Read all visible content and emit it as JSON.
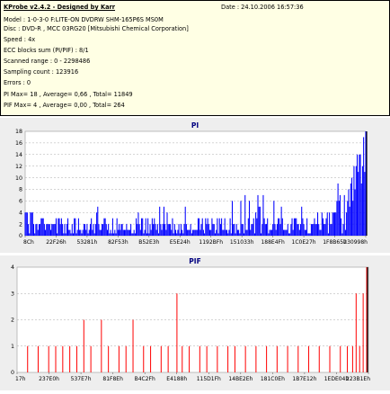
{
  "info": {
    "title": "KProbe v2.4.2 - Designed by Karr",
    "date": "Date : 24.10.2006 16:57:36",
    "lines": [
      "Model : 1-0-3-0 F:LITE-ON DVDRW SHM-165P6S MS0M",
      "Disc : DVD-R , MCC 03RG20  [Mitsubishi Chemical Corporation]",
      "Speed : 4x",
      "ECC blocks sum (PI/PIF) : 8/1",
      "Scanned range : 0 - 2298486",
      "Sampling count : 123916",
      "Errors : 0",
      "PI Max= 18 , Average= 0,66 , Total= 11849",
      "PIF Max= 4 , Average= 0,00 , Total= 264"
    ]
  },
  "colors": {
    "panel_bg": "#ffffe4",
    "chart_bg": "#eeeeee",
    "plot_bg": "#ffffff",
    "pi_bars": "#0000ff",
    "pif_bars": "#ff0000",
    "title_text": "#000080",
    "end_marker": "#000000"
  },
  "chart_data": [
    {
      "type": "bar",
      "title": "PI",
      "ylim": [
        0,
        18
      ],
      "yticks": [
        0,
        2,
        4,
        6,
        8,
        10,
        12,
        14,
        16,
        18
      ],
      "x_tick_labels": [
        "8Ch",
        "22F26h",
        "53281h",
        "82F53h",
        "B52E3h",
        "E5E24h",
        "1192BFh",
        "151033h",
        "188E4Fh",
        "1C0E27h",
        "1F8B65h",
        "230998h"
      ],
      "grid": true,
      "summary": {
        "max": 18,
        "average": 0.66,
        "total": 11849
      },
      "profile": [
        {
          "x_fraction": 0.0,
          "typical_max": 4,
          "peaks": 6
        },
        {
          "x_fraction": 0.1,
          "typical_max": 3,
          "peaks": 5
        },
        {
          "x_fraction": 0.5,
          "typical_max": 3,
          "peaks": 6
        },
        {
          "x_fraction": 0.8,
          "typical_max": 3,
          "peaks": 9
        },
        {
          "x_fraction": 0.9,
          "typical_max": 4,
          "peaks": 8
        },
        {
          "x_fraction": 1.0,
          "typical_max": 16,
          "peaks": 18
        }
      ]
    },
    {
      "type": "bar",
      "title": "PIF",
      "ylim": [
        0,
        4
      ],
      "yticks": [
        0,
        1,
        2,
        3,
        4
      ],
      "x_tick_labels": [
        "17h",
        "237E0h",
        "537E7h",
        "81F8Eh",
        "B4C2Fh",
        "E4188h",
        "115D1Fh",
        "14BE2Eh",
        "181C0Eh",
        "1B7E12h",
        "1EDE04h",
        "223B1Eh"
      ],
      "grid": true,
      "summary": {
        "max": 4,
        "average": 0.0,
        "total": 264
      },
      "spikes": [
        {
          "x_fraction": 0.03,
          "value": 1
        },
        {
          "x_fraction": 0.06,
          "value": 1
        },
        {
          "x_fraction": 0.09,
          "value": 1
        },
        {
          "x_fraction": 0.11,
          "value": 1
        },
        {
          "x_fraction": 0.13,
          "value": 1
        },
        {
          "x_fraction": 0.15,
          "value": 1
        },
        {
          "x_fraction": 0.17,
          "value": 1
        },
        {
          "x_fraction": 0.19,
          "value": 2
        },
        {
          "x_fraction": 0.21,
          "value": 1
        },
        {
          "x_fraction": 0.24,
          "value": 2
        },
        {
          "x_fraction": 0.26,
          "value": 1
        },
        {
          "x_fraction": 0.29,
          "value": 1
        },
        {
          "x_fraction": 0.31,
          "value": 1
        },
        {
          "x_fraction": 0.33,
          "value": 2
        },
        {
          "x_fraction": 0.36,
          "value": 1
        },
        {
          "x_fraction": 0.38,
          "value": 1
        },
        {
          "x_fraction": 0.41,
          "value": 1
        },
        {
          "x_fraction": 0.43,
          "value": 1
        },
        {
          "x_fraction": 0.455,
          "value": 3
        },
        {
          "x_fraction": 0.47,
          "value": 1
        },
        {
          "x_fraction": 0.49,
          "value": 1
        },
        {
          "x_fraction": 0.52,
          "value": 1
        },
        {
          "x_fraction": 0.54,
          "value": 1
        },
        {
          "x_fraction": 0.57,
          "value": 1
        },
        {
          "x_fraction": 0.6,
          "value": 1
        },
        {
          "x_fraction": 0.62,
          "value": 1
        },
        {
          "x_fraction": 0.65,
          "value": 1
        },
        {
          "x_fraction": 0.68,
          "value": 1
        },
        {
          "x_fraction": 0.71,
          "value": 1
        },
        {
          "x_fraction": 0.74,
          "value": 1
        },
        {
          "x_fraction": 0.77,
          "value": 1
        },
        {
          "x_fraction": 0.8,
          "value": 1
        },
        {
          "x_fraction": 0.83,
          "value": 1
        },
        {
          "x_fraction": 0.86,
          "value": 1
        },
        {
          "x_fraction": 0.89,
          "value": 1
        },
        {
          "x_fraction": 0.92,
          "value": 1
        },
        {
          "x_fraction": 0.94,
          "value": 1
        },
        {
          "x_fraction": 0.955,
          "value": 1
        },
        {
          "x_fraction": 0.965,
          "value": 3
        },
        {
          "x_fraction": 0.975,
          "value": 1
        },
        {
          "x_fraction": 0.985,
          "value": 3
        },
        {
          "x_fraction": 0.995,
          "value": 4
        }
      ]
    }
  ]
}
